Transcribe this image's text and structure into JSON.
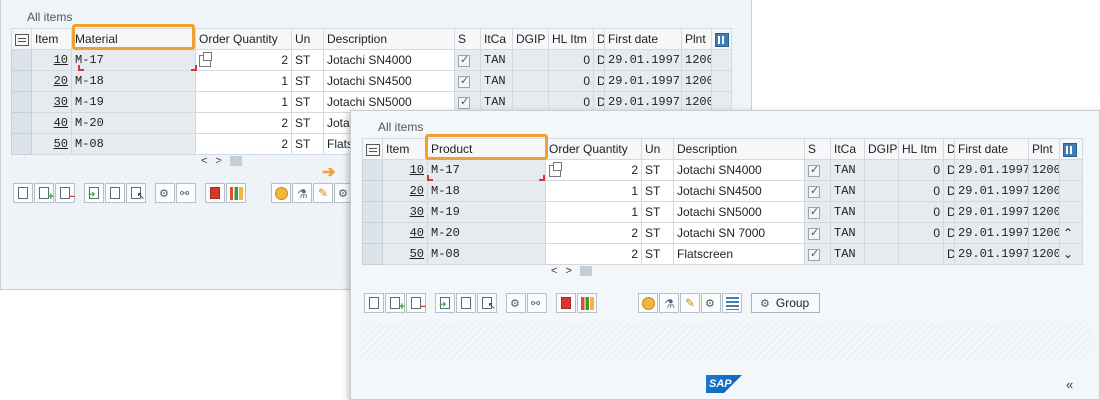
{
  "back_panel": {
    "section_title": "All items",
    "columns": [
      "Item",
      "Material",
      "Order Quantity",
      "Un",
      "Description",
      "S",
      "ItCa",
      "DGIP",
      "HL Itm",
      "D",
      "First date",
      "Plnt"
    ],
    "rows": [
      {
        "item": "10",
        "material": "M-17",
        "qty": "2",
        "un": "ST",
        "desc": "Jotachi SN4000",
        "itca": "TAN",
        "hl": "0",
        "d": "D",
        "date": "29.01.1997",
        "plnt": "1200"
      },
      {
        "item": "20",
        "material": "M-18",
        "qty": "1",
        "un": "ST",
        "desc": "Jotachi SN4500",
        "itca": "TAN",
        "hl": "0",
        "d": "D",
        "date": "29.01.1997",
        "plnt": "1200"
      },
      {
        "item": "30",
        "material": "M-19",
        "qty": "1",
        "un": "ST",
        "desc": "Jotachi SN5000",
        "itca": "TAN",
        "hl": "0",
        "d": "D",
        "date": "29.01.1997",
        "plnt": "1200"
      },
      {
        "item": "40",
        "material": "M-20",
        "qty": "2",
        "un": "ST",
        "desc": "Jotac",
        "itca": "",
        "hl": "",
        "d": "",
        "date": "",
        "plnt": ""
      },
      {
        "item": "50",
        "material": "M-08",
        "qty": "2",
        "un": "ST",
        "desc": "Flats",
        "itca": "",
        "hl": "",
        "d": "",
        "date": "",
        "plnt": ""
      }
    ]
  },
  "front_panel": {
    "section_title": "All items",
    "columns": [
      "Item",
      "Product",
      "Order Quantity",
      "Un",
      "Description",
      "S",
      "ItCa",
      "DGIP",
      "HL Itm",
      "D",
      "First date",
      "Plnt"
    ],
    "rows": [
      {
        "item": "10",
        "material": "M-17",
        "qty": "2",
        "un": "ST",
        "desc": "Jotachi SN4000",
        "itca": "TAN",
        "hl": "0",
        "d": "D",
        "date": "29.01.1997",
        "plnt": "1200"
      },
      {
        "item": "20",
        "material": "M-18",
        "qty": "1",
        "un": "ST",
        "desc": "Jotachi SN4500",
        "itca": "TAN",
        "hl": "0",
        "d": "D",
        "date": "29.01.1997",
        "plnt": "1200"
      },
      {
        "item": "30",
        "material": "M-19",
        "qty": "1",
        "un": "ST",
        "desc": "Jotachi SN5000",
        "itca": "TAN",
        "hl": "0",
        "d": "D",
        "date": "29.01.1997",
        "plnt": "1200"
      },
      {
        "item": "40",
        "material": "M-20",
        "qty": "2",
        "un": "ST",
        "desc": "Jotachi SN 7000",
        "itca": "TAN",
        "hl": "0",
        "d": "D",
        "date": "29.01.1997",
        "plnt": "1200"
      },
      {
        "item": "50",
        "material": "M-08",
        "qty": "2",
        "un": "ST",
        "desc": "Flatscreen",
        "itca": "TAN",
        "hl": "",
        "d": "D",
        "date": "29.01.1997",
        "plnt": "1200"
      }
    ],
    "group_button": "Group"
  },
  "footer": {
    "logo": "SAP",
    "collapse": "«"
  },
  "colors": {
    "highlight": "#f0a030",
    "panel_bg": "#eff4f9"
  }
}
